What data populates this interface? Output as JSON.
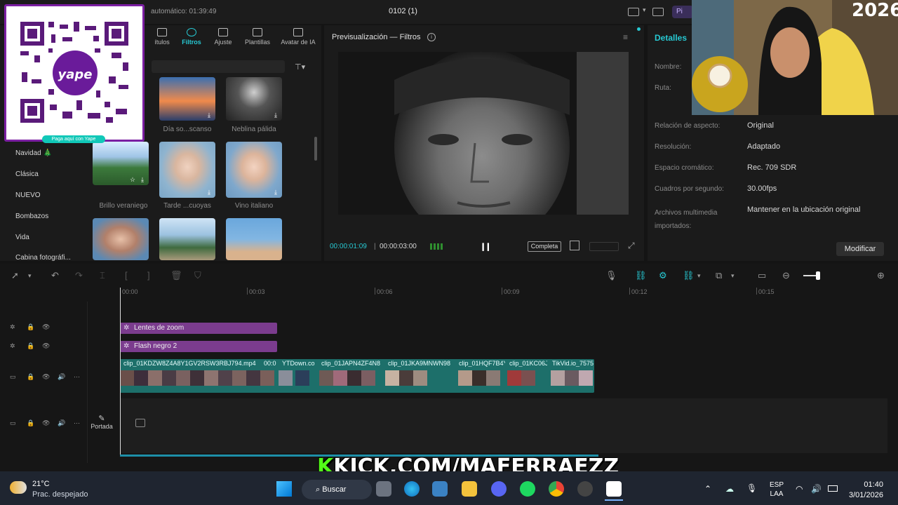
{
  "topbar": {
    "autosave": "automático: 01:39:49",
    "project_title": "0102 (1)",
    "pro_badge": "Pi"
  },
  "media_tabs": [
    {
      "label": "ítulos",
      "icon": "titles-icon"
    },
    {
      "label": "Filtros",
      "icon": "filters-icon",
      "active": true
    },
    {
      "label": "Ajuste",
      "icon": "adjust-icon"
    },
    {
      "label": "Plantillas",
      "icon": "templates-icon"
    },
    {
      "label": "Avatar de IA",
      "icon": "avatar-icon"
    }
  ],
  "categories": [
    "Navidad 🎄",
    "Clásica",
    "NUEVO",
    "Bombazos",
    "Vida",
    "Cabina fotográfi..."
  ],
  "filters": [
    {
      "label": "Día so...scanso"
    },
    {
      "label": "Neblina pálida"
    },
    {
      "label": "Brillo veraniego"
    },
    {
      "label": "Tarde ...cuoyas"
    },
    {
      "label": "Vino italiano"
    }
  ],
  "preview": {
    "title": "Previsualización — Filtros",
    "current_time": "00:00:01:09",
    "total_time": "00:00:03:00",
    "full_label": "Completa"
  },
  "details": {
    "title": "Detalles",
    "rows": [
      {
        "key": "Nombre:",
        "value": ""
      },
      {
        "key": "Ruta:",
        "value": ""
      },
      {
        "key": "Relación de aspecto:",
        "value": "Original"
      },
      {
        "key": "Resolución:",
        "value": "Adaptado"
      },
      {
        "key": "Espacio cromático:",
        "value": "Rec. 709 SDR"
      },
      {
        "key": "Cuadros por segundo:",
        "value": "30.00fps"
      },
      {
        "key": "Archivos multimedia importados:",
        "value": "Mantener en la ubicación original"
      }
    ],
    "modify_label": "Modificar"
  },
  "overlay": {
    "qr_caption": "Paga aquí con Yape",
    "qr_brand": "yape",
    "year": "2026"
  },
  "timeline": {
    "ruler": [
      "00:00",
      "00:03",
      "00:06",
      "00:09",
      "00:12",
      "00:15"
    ],
    "effect_clips": [
      "Lentes de zoom",
      "Flash negro 2"
    ],
    "video_clips": [
      "clip_01KDZW8Z4A8Y1GV2RSW3RBJ794.mp4",
      "00:0",
      "YTDown.co",
      "clip_01JAPN4ZF4N8",
      "clip_01JKA9MNWN98",
      "clip_01HQF7B4Y",
      "clip_01KC06J",
      "TikVid.io_7575"
    ],
    "cover_label": "Portada"
  },
  "banner": {
    "k": "K",
    "text": "KICK.COM/MAFERRAEZZ"
  },
  "taskbar": {
    "temperature": "21°C",
    "weather": "Prac. despejado",
    "search": "Buscar",
    "lang1": "ESP",
    "lang2": "LAA",
    "time": "01:40",
    "date": "3/01/2026"
  },
  "colors": {
    "accent": "#27c9d3",
    "effect_clip": "#7b3c8e",
    "video_track": "#1d6f6a",
    "kick_green": "#53fc18",
    "qr_border": "#7b1fa2"
  }
}
